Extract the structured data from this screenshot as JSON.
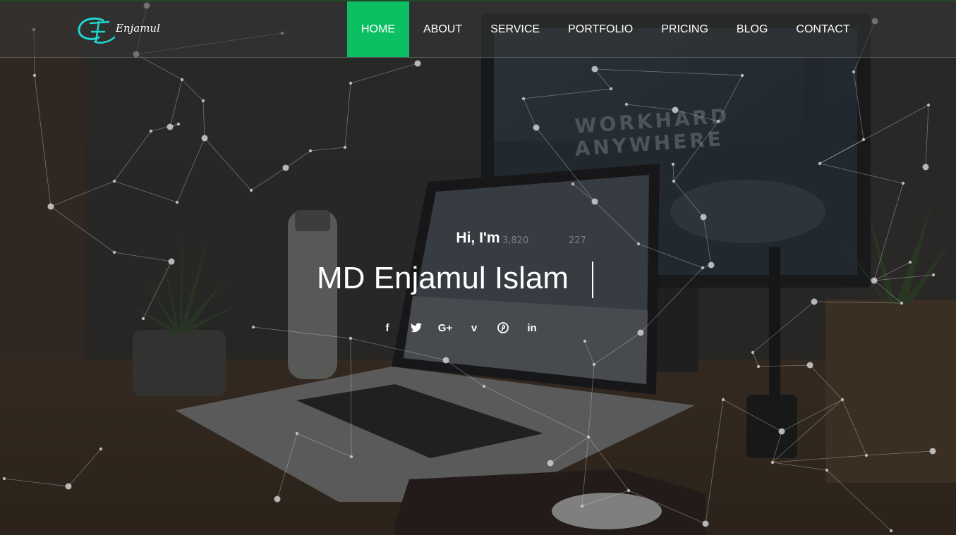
{
  "brand": {
    "name": "Enjamul"
  },
  "nav": {
    "items": [
      {
        "label": "HOME",
        "active": true
      },
      {
        "label": "ABOUT"
      },
      {
        "label": "SERVICE"
      },
      {
        "label": "PORTFOLIO"
      },
      {
        "label": "PRICING"
      },
      {
        "label": "BLOG"
      },
      {
        "label": "CONTACT"
      }
    ]
  },
  "hero": {
    "greeting": "Hi, I'm",
    "name": "MD Enjamul Islam",
    "background_image_text": [
      "WORKHARD",
      "ANYWHERE",
      "3,820",
      "227"
    ]
  },
  "social": [
    {
      "icon": "facebook-icon",
      "glyph": "f"
    },
    {
      "icon": "twitter-icon",
      "glyph": "t"
    },
    {
      "icon": "google-plus-icon",
      "glyph": "G+"
    },
    {
      "icon": "vimeo-icon",
      "glyph": "v"
    },
    {
      "icon": "pinterest-icon",
      "glyph": "p"
    },
    {
      "icon": "linkedin-icon",
      "glyph": "in"
    }
  ],
  "colors": {
    "accent": "#0dbf63",
    "logo": "#1fd6cf",
    "overlay": "#2c2c2c",
    "text": "#ffffff"
  }
}
